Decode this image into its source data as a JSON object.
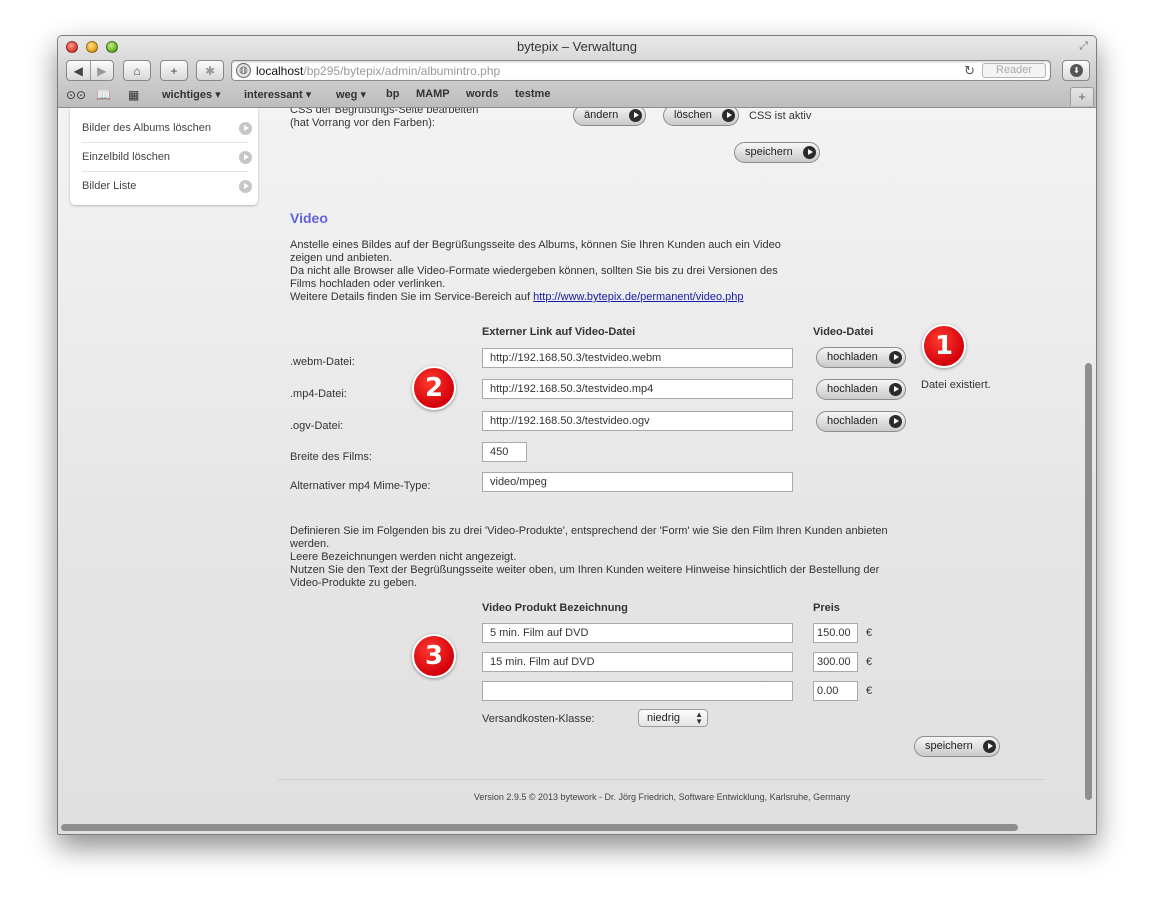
{
  "window": {
    "title": "bytepix – Verwaltung",
    "url_host": "localhost",
    "url_path": "/bp295/bytepix/admin/albumintro.php",
    "reader_label": "Reader"
  },
  "bookmarks": [
    "wichtiges ▾",
    "interessant ▾",
    "weg ▾",
    "bp",
    "MAMP",
    "words",
    "testme"
  ],
  "sidebar": {
    "items": [
      {
        "label": "Bilder des Albums löschen"
      },
      {
        "label": "Einzelbild löschen"
      },
      {
        "label": "Bilder Liste"
      }
    ]
  },
  "css_section": {
    "label_line1": "CSS der Begrüßungs-Seite bearbeiten",
    "label_line2": "(hat Vorrang vor den Farben):",
    "edit_button": "ändern",
    "delete_button": "löschen",
    "status": "CSS ist aktiv",
    "save_button": "speichern"
  },
  "video": {
    "heading": "Video",
    "intro": [
      "Anstelle eines Bildes auf der Begrüßungsseite des Albums, können Sie Ihren Kunden auch ein Video",
      "zeigen und anbieten.",
      "Da nicht alle Browser alle Video-Formate wiedergeben können, sollten Sie bis zu drei Versionen des",
      "Films hochladen oder verlinken."
    ],
    "details_prefix": "Weitere Details finden Sie im Service-Bereich auf ",
    "details_link": "http://www.bytepix.de/permanent/video.php",
    "col_external": "Externer Link auf Video-Datei",
    "col_file": "Video-Datei",
    "rows": [
      {
        "label": ".webm-Datei:",
        "value": "http://192.168.50.3/testvideo.webm",
        "button": "hochladen"
      },
      {
        "label": ".mp4-Datei:",
        "value": "http://192.168.50.3/testvideo.mp4",
        "button": "hochladen"
      },
      {
        "label": ".ogv-Datei:",
        "value": "http://192.168.50.3/testvideo.ogv",
        "button": "hochladen"
      }
    ],
    "file_status": "Datei existiert.",
    "width_label": "Breite des Films:",
    "width_value": "450",
    "mime_label": "Alternativer mp4 Mime-Type:",
    "mime_value": "video/mpeg"
  },
  "products": {
    "intro": [
      "Definieren Sie im Folgenden bis zu drei 'Video-Produkte', entsprechend der 'Form' wie Sie den Film Ihren Kunden anbieten",
      "werden.",
      "Leere Bezeichnungen werden nicht angezeigt.",
      "Nutzen Sie den Text der Begrüßungsseite weiter oben, um Ihren Kunden weitere Hinweise hinsichtlich der Bestellung der",
      "Video-Produkte zu geben."
    ],
    "col_name": "Video Produkt Bezeichnung",
    "col_price": "Preis",
    "items": [
      {
        "name": "5 min. Film auf DVD",
        "price": "150.00",
        "currency": "€"
      },
      {
        "name": "15 min. Film auf DVD",
        "price": "300.00",
        "currency": "€"
      },
      {
        "name": "",
        "price": "0.00",
        "currency": "€"
      }
    ],
    "shipping_label": "Versandkosten-Klasse:",
    "shipping_value": "niedrig",
    "save_button": "speichern"
  },
  "badges": [
    "1",
    "2",
    "3"
  ],
  "footer": "Version 2.9.5 © 2013 bytework - Dr. Jörg Friedrich, Software Entwicklung, Karlsruhe, Germany"
}
